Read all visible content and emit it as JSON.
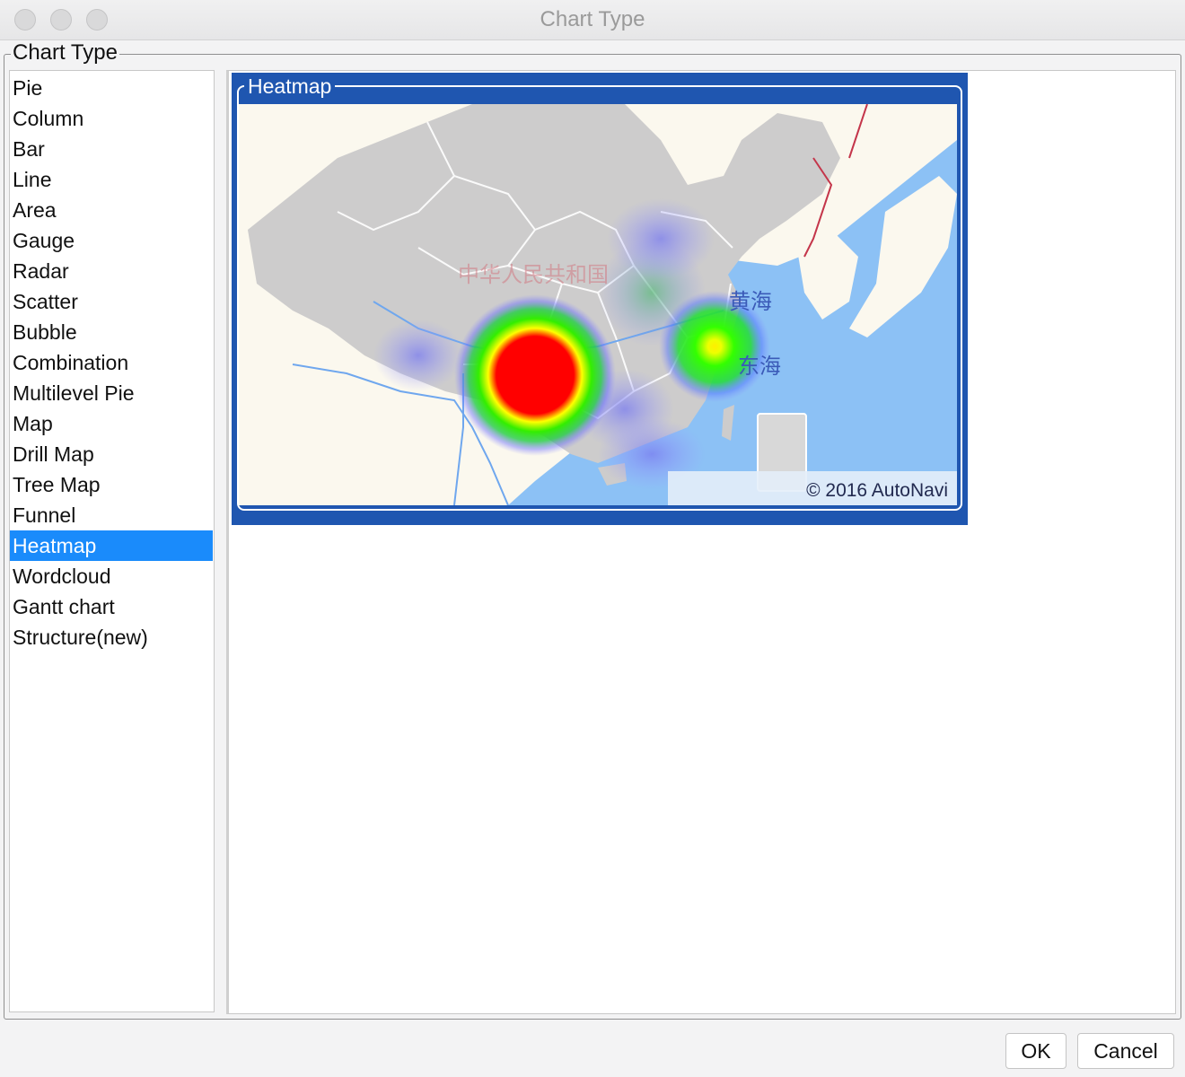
{
  "window": {
    "title": "Chart Type"
  },
  "group": {
    "legend": "Chart Type"
  },
  "chart_types": [
    {
      "label": "Pie"
    },
    {
      "label": "Column"
    },
    {
      "label": "Bar"
    },
    {
      "label": "Line"
    },
    {
      "label": "Area"
    },
    {
      "label": "Gauge"
    },
    {
      "label": "Radar"
    },
    {
      "label": "Scatter"
    },
    {
      "label": "Bubble"
    },
    {
      "label": "Combination"
    },
    {
      "label": "Multilevel Pie"
    },
    {
      "label": "Map"
    },
    {
      "label": "Drill Map"
    },
    {
      "label": "Tree Map"
    },
    {
      "label": "Funnel"
    },
    {
      "label": "Heatmap"
    },
    {
      "label": "Wordcloud"
    },
    {
      "label": "Gantt chart"
    },
    {
      "label": "Structure(new)"
    }
  ],
  "selected_index": 15,
  "preview": {
    "legend": "Heatmap",
    "map_labels": {
      "country": "中华人民共和国",
      "yellow_sea": "黄海",
      "east_sea": "东海"
    },
    "copyright": "© 2016 AutoNavi"
  },
  "buttons": {
    "ok": "OK",
    "cancel": "Cancel"
  },
  "colors": {
    "selection": "#1a8bfb",
    "preview_frame": "#1f56b0",
    "sea": "#8cc1f5",
    "land_china": "#cdcccc",
    "land_other": "#fbf8ee"
  }
}
